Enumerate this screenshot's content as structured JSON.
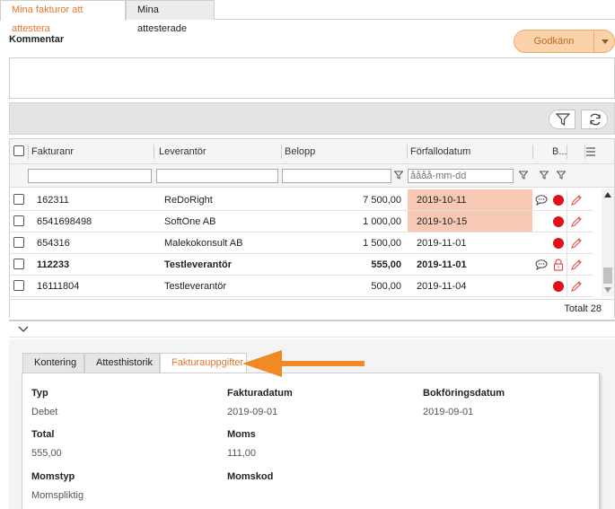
{
  "tabs": {
    "active": "Mina fakturor att attestera",
    "inactive": "Mina attesterade"
  },
  "comment": {
    "label": "Kommentar",
    "value": ""
  },
  "approve": {
    "label": "Godkänn"
  },
  "grid": {
    "columns": {
      "invoice_no": "Fakturanr",
      "supplier": "Leverantör",
      "amount": "Belopp",
      "due_date": "Förfallodatum",
      "b": "B..."
    },
    "due_date_placeholder": "åååå-mm-dd",
    "rows": [
      {
        "invoice_no": "162311",
        "supplier": "ReDoRight",
        "amount": "7 500,00",
        "due_date": "2019-10-11",
        "highlight": true,
        "comment": true,
        "status": "red-dot",
        "bold": false
      },
      {
        "invoice_no": "6541698498",
        "supplier": "SoftOne AB",
        "amount": "1 000,00",
        "due_date": "2019-10-15",
        "highlight": true,
        "comment": false,
        "status": "red-dot",
        "bold": false
      },
      {
        "invoice_no": "654316",
        "supplier": "Malekokonsult AB",
        "amount": "1 500,00",
        "due_date": "2019-11-01",
        "highlight": false,
        "comment": false,
        "status": "red-dot",
        "bold": false
      },
      {
        "invoice_no": "112233",
        "supplier": "Testleverantör",
        "amount": "555,00",
        "due_date": "2019-11-01",
        "highlight": false,
        "comment": true,
        "status": "lock",
        "bold": true
      },
      {
        "invoice_no": "16111804",
        "supplier": "Testleverantör",
        "amount": "500,00",
        "due_date": "2019-11-04",
        "highlight": false,
        "comment": false,
        "status": "red-dot",
        "bold": false
      }
    ],
    "total": "Totalt 28"
  },
  "detail_tabs": {
    "kontering": "Kontering",
    "attesthistorik": "Attesthistorik",
    "fakturauppgifter": "Fakturauppgifter"
  },
  "details": {
    "typ": {
      "label": "Typ",
      "value": "Debet"
    },
    "fakturadatum": {
      "label": "Fakturadatum",
      "value": "2019-09-01"
    },
    "bokforingsdatum": {
      "label": "Bokföringsdatum",
      "value": "2019-09-01"
    },
    "total": {
      "label": "Total",
      "value": "555,00"
    },
    "moms": {
      "label": "Moms",
      "value": "111,00"
    },
    "momstyp": {
      "label": "Momstyp",
      "value": "Momspliktig"
    },
    "momskod": {
      "label": "Momskod",
      "value": ""
    }
  },
  "colors": {
    "accent": "#e8752b",
    "highlight": "#f7c8b4",
    "status_red": "#e0101a",
    "arrow": "#f08a24"
  }
}
